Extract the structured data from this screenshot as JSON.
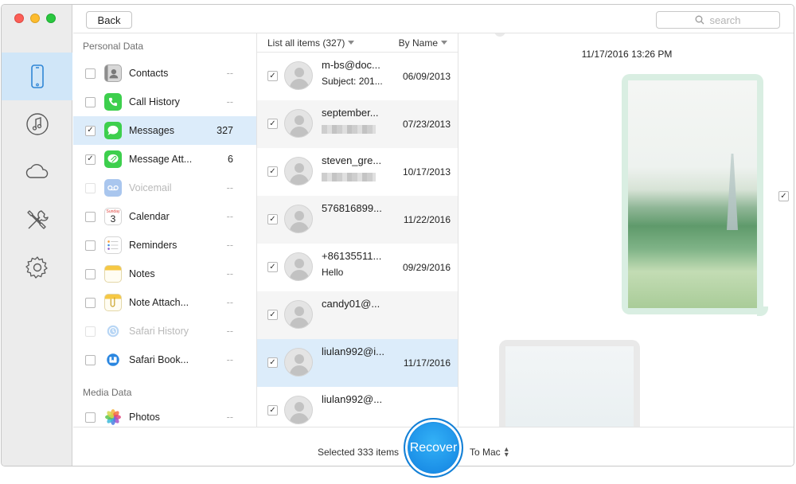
{
  "toolbar": {
    "back_label": "Back",
    "search_placeholder": "search"
  },
  "rail": {
    "items": [
      {
        "icon": "iphone-icon",
        "active": true
      },
      {
        "icon": "music-icon"
      },
      {
        "icon": "cloud-icon"
      },
      {
        "icon": "tools-icon"
      },
      {
        "icon": "gear-icon"
      }
    ]
  },
  "categories": {
    "personal_title": "Personal Data",
    "media_title": "Media Data",
    "items": [
      {
        "label": "Contacts",
        "count": "--",
        "checked": false,
        "icon": "contacts-icon"
      },
      {
        "label": "Call History",
        "count": "--",
        "checked": false,
        "icon": "phone-icon"
      },
      {
        "label": "Messages",
        "count": "327",
        "checked": true,
        "selected": true,
        "icon": "messages-icon"
      },
      {
        "label": "Message Att...",
        "count": "6",
        "checked": true,
        "icon": "message-attachment-icon"
      },
      {
        "label": "Voicemail",
        "count": "--",
        "checked": false,
        "disabled": true,
        "icon": "voicemail-icon"
      },
      {
        "label": "Calendar",
        "count": "--",
        "checked": false,
        "icon": "calendar-icon"
      },
      {
        "label": "Reminders",
        "count": "--",
        "checked": false,
        "icon": "reminders-icon"
      },
      {
        "label": "Notes",
        "count": "--",
        "checked": false,
        "icon": "notes-icon"
      },
      {
        "label": "Note Attach...",
        "count": "--",
        "checked": false,
        "icon": "note-attachment-icon"
      },
      {
        "label": "Safari History",
        "count": "--",
        "checked": false,
        "disabled": true,
        "icon": "safari-history-icon"
      },
      {
        "label": "Safari Book...",
        "count": "--",
        "checked": false,
        "icon": "safari-bookmark-icon"
      },
      {
        "label": "Photos",
        "count": "--",
        "checked": false,
        "icon": "photos-icon"
      }
    ],
    "calendar_icon_day": "3",
    "calendar_icon_weekday": "Sunday"
  },
  "list": {
    "header_left": "List all items (327)",
    "header_right": "By Name",
    "items": [
      {
        "name": "m-bs@doc...",
        "sub": "Subject: 201...",
        "date": "06/09/2013",
        "checked": true
      },
      {
        "name": "september...",
        "sub": "",
        "blurred": true,
        "date": "07/23/2013",
        "checked": true
      },
      {
        "name": "steven_gre...",
        "sub": "",
        "blurred": true,
        "date": "10/17/2013",
        "checked": true
      },
      {
        "name": "576816899...",
        "sub": "",
        "date": "11/22/2016",
        "checked": true
      },
      {
        "name": "+86135511...",
        "sub": "Hello",
        "date": "09/29/2016",
        "checked": true
      },
      {
        "name": "candy01@...",
        "sub": "",
        "date": "",
        "checked": true
      },
      {
        "name": "liulan992@i...",
        "sub": "",
        "date": "11/17/2016",
        "checked": true,
        "selected": true
      },
      {
        "name": "liulan992@...",
        "sub": "",
        "date": "",
        "checked": true
      }
    ]
  },
  "preview": {
    "timestamp": "11/17/2016 13:26 PM"
  },
  "footer": {
    "selected_text": "Selected 333 items",
    "recover_label": "Recover",
    "destination": "To Mac"
  },
  "colors": {
    "accent": "#1a8de6",
    "selection": "#dcecfa",
    "rail_active": "#d0e6f8",
    "sent_bubble": "#d9eee2"
  }
}
